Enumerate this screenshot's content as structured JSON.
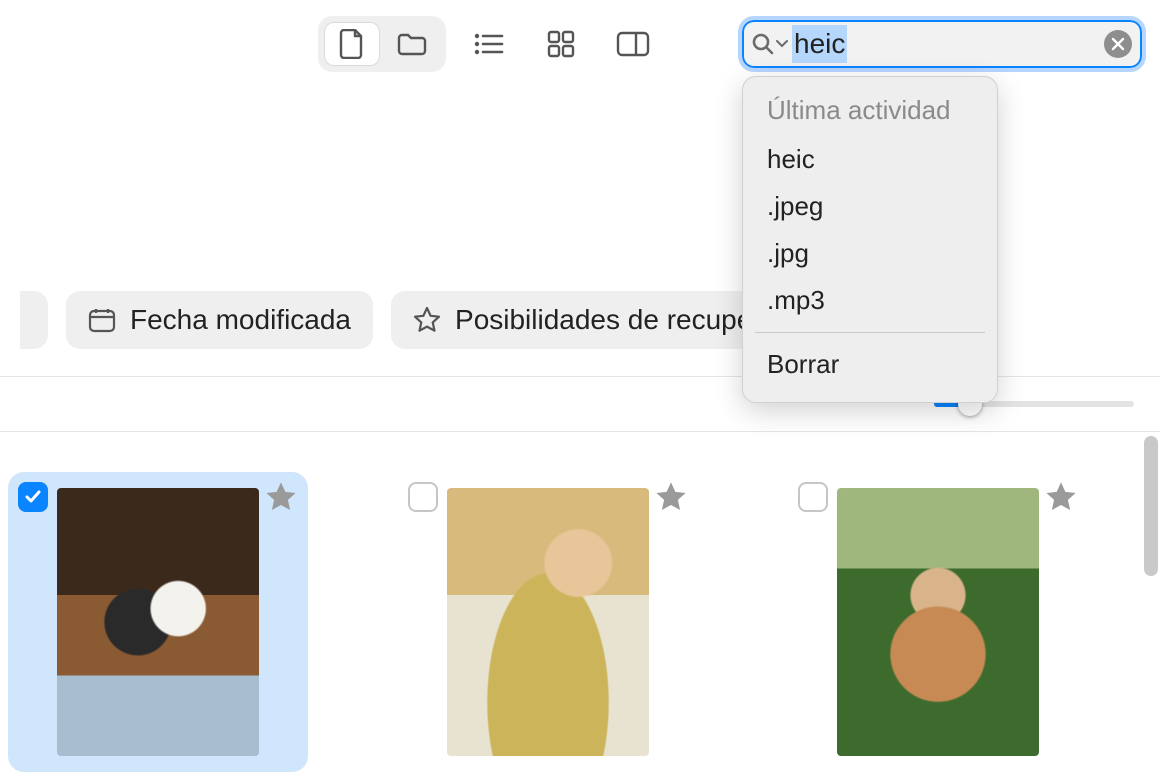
{
  "search": {
    "value": "heic",
    "dropdown_header": "Última actividad",
    "suggestions": [
      "heic",
      ".jpeg",
      ".jpg",
      ".mp3"
    ],
    "clear_label": "Borrar"
  },
  "filters": {
    "date_modified": "Fecha modificada",
    "recoverability": "Posibilidades de recuperaci"
  },
  "cards": [
    {
      "selected": true,
      "starred": false
    },
    {
      "selected": false,
      "starred": false
    },
    {
      "selected": false,
      "starred": false
    }
  ],
  "slider": {
    "percent": 18
  }
}
